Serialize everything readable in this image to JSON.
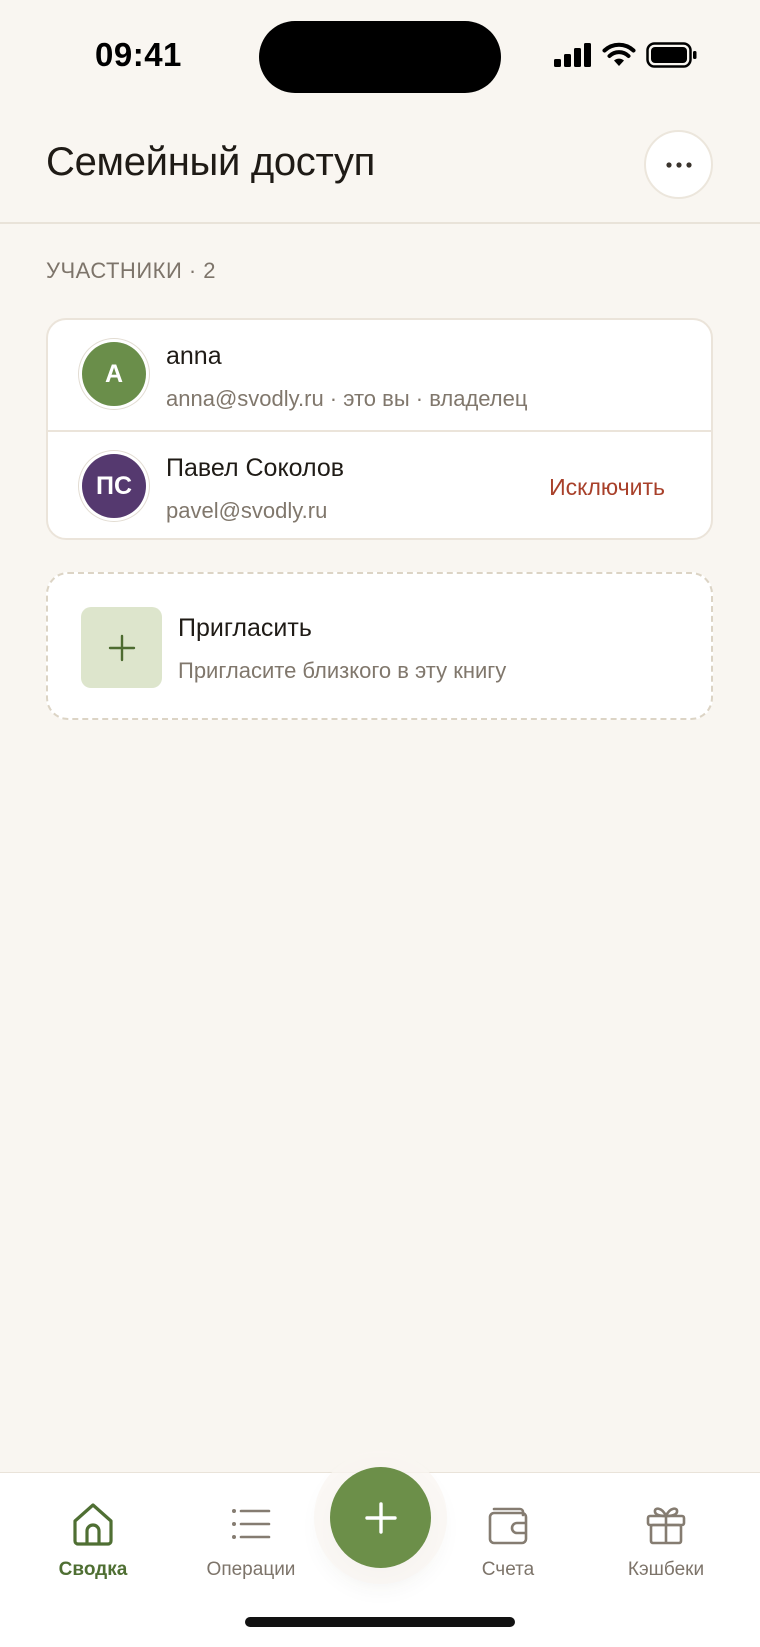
{
  "status_bar": {
    "time": "09:41"
  },
  "header": {
    "title": "Семейный доступ"
  },
  "members": {
    "label": "УЧАСТНИКИ · 2",
    "items": [
      {
        "initials": "A",
        "name": "anna",
        "meta": "anna@svodly.ru · это вы · владелец",
        "color": "#6a8e4a"
      },
      {
        "initials": "ПС",
        "name": "Павел Соколов",
        "meta": "pavel@svodly.ru",
        "color": "#55396f",
        "action": "Исключить"
      }
    ]
  },
  "invite": {
    "title": "Пригласить",
    "subtitle": "Пригласите близкого в эту книгу"
  },
  "tab_bar": {
    "items": [
      {
        "label": "Сводка",
        "icon": "home-icon",
        "active": true
      },
      {
        "label": "Операции",
        "icon": "list-icon",
        "active": false
      },
      {
        "label": "Счета",
        "icon": "wallet-icon",
        "active": false
      },
      {
        "label": "Кэшбеки",
        "icon": "gift-icon",
        "active": false
      }
    ],
    "fab_icon": "plus-icon"
  },
  "colors": {
    "accent": "#6c8f49",
    "danger": "#a8402a",
    "background": "#f9f6f1"
  }
}
